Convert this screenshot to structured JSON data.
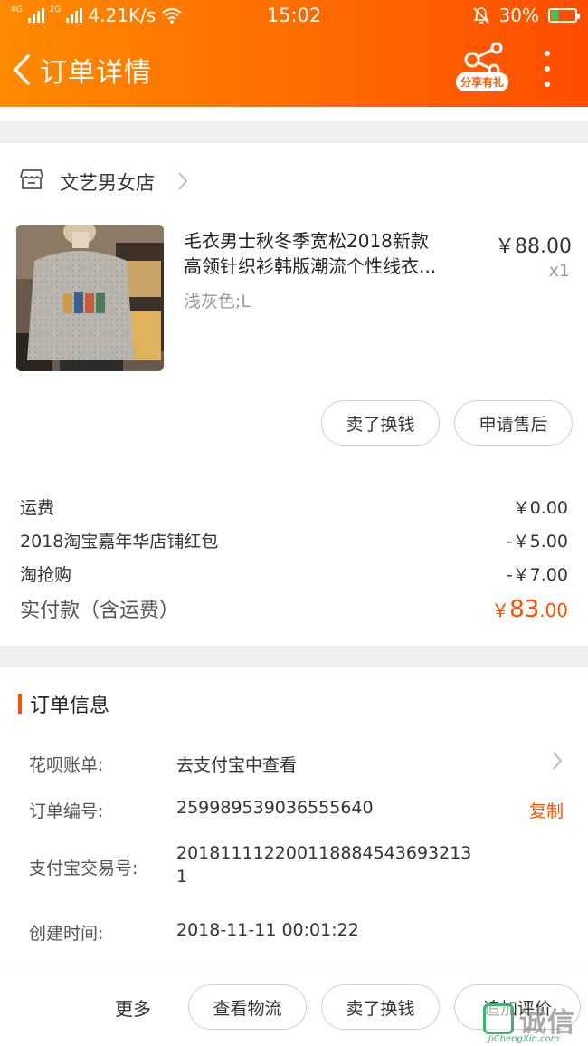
{
  "status_bar": {
    "network_speed": "4.21K/s",
    "time": "15:02",
    "battery": "30%",
    "signal_tag_1": "4G",
    "signal_tag_2": "2G",
    "battery_level": 0.3
  },
  "header": {
    "back_icon": "chevron-left-icon",
    "title": "订单详情",
    "share_label": "分享有礼",
    "more_icon": "vertical-dots-icon",
    "gradient_start": "#ff8a00",
    "gradient_end": "#ff4d00"
  },
  "shop": {
    "icon": "store-icon",
    "name": "文艺男女店"
  },
  "product": {
    "title_line1": "毛衣男士秋冬季宽松2018新款",
    "title_line2": "高领针织衫韩版潮流个性线衣...",
    "sku": "浅灰色;L",
    "price": "￥88.00",
    "quantity": "x1"
  },
  "item_actions": {
    "sell_label": "卖了换钱",
    "after_sale_label": "申请售后"
  },
  "fees": [
    {
      "label": "运费",
      "value": "￥0.00"
    },
    {
      "label": "2018淘宝嘉年华店铺红包",
      "value": "-￥5.00"
    },
    {
      "label": "淘抢购",
      "value": "-￥7.00"
    }
  ],
  "total": {
    "label": "实付款（含运费）",
    "currency": "￥",
    "integer": "83",
    "decimal": ".00",
    "accent_color": "#ff5000"
  },
  "order_info": {
    "section_title": "订单信息",
    "rows": [
      {
        "label": "花呗账单:",
        "value": "去支付宝中查看"
      },
      {
        "label": "订单编号:",
        "value": "259989539036555640"
      },
      {
        "label": "支付宝交易号:",
        "value_line1": "201811112200118884543693213",
        "value_line2": "1"
      },
      {
        "label": "创建时间:",
        "value": "2018-11-11 00:01:22"
      }
    ],
    "copy_label": "复制"
  },
  "bottom_bar": {
    "more_label": "更多",
    "logistics_label": "查看物流",
    "sell_label": "卖了换钱",
    "review_label": "追加评价"
  },
  "watermark": {
    "text": "诚信",
    "url": "JiChengXin.com"
  }
}
